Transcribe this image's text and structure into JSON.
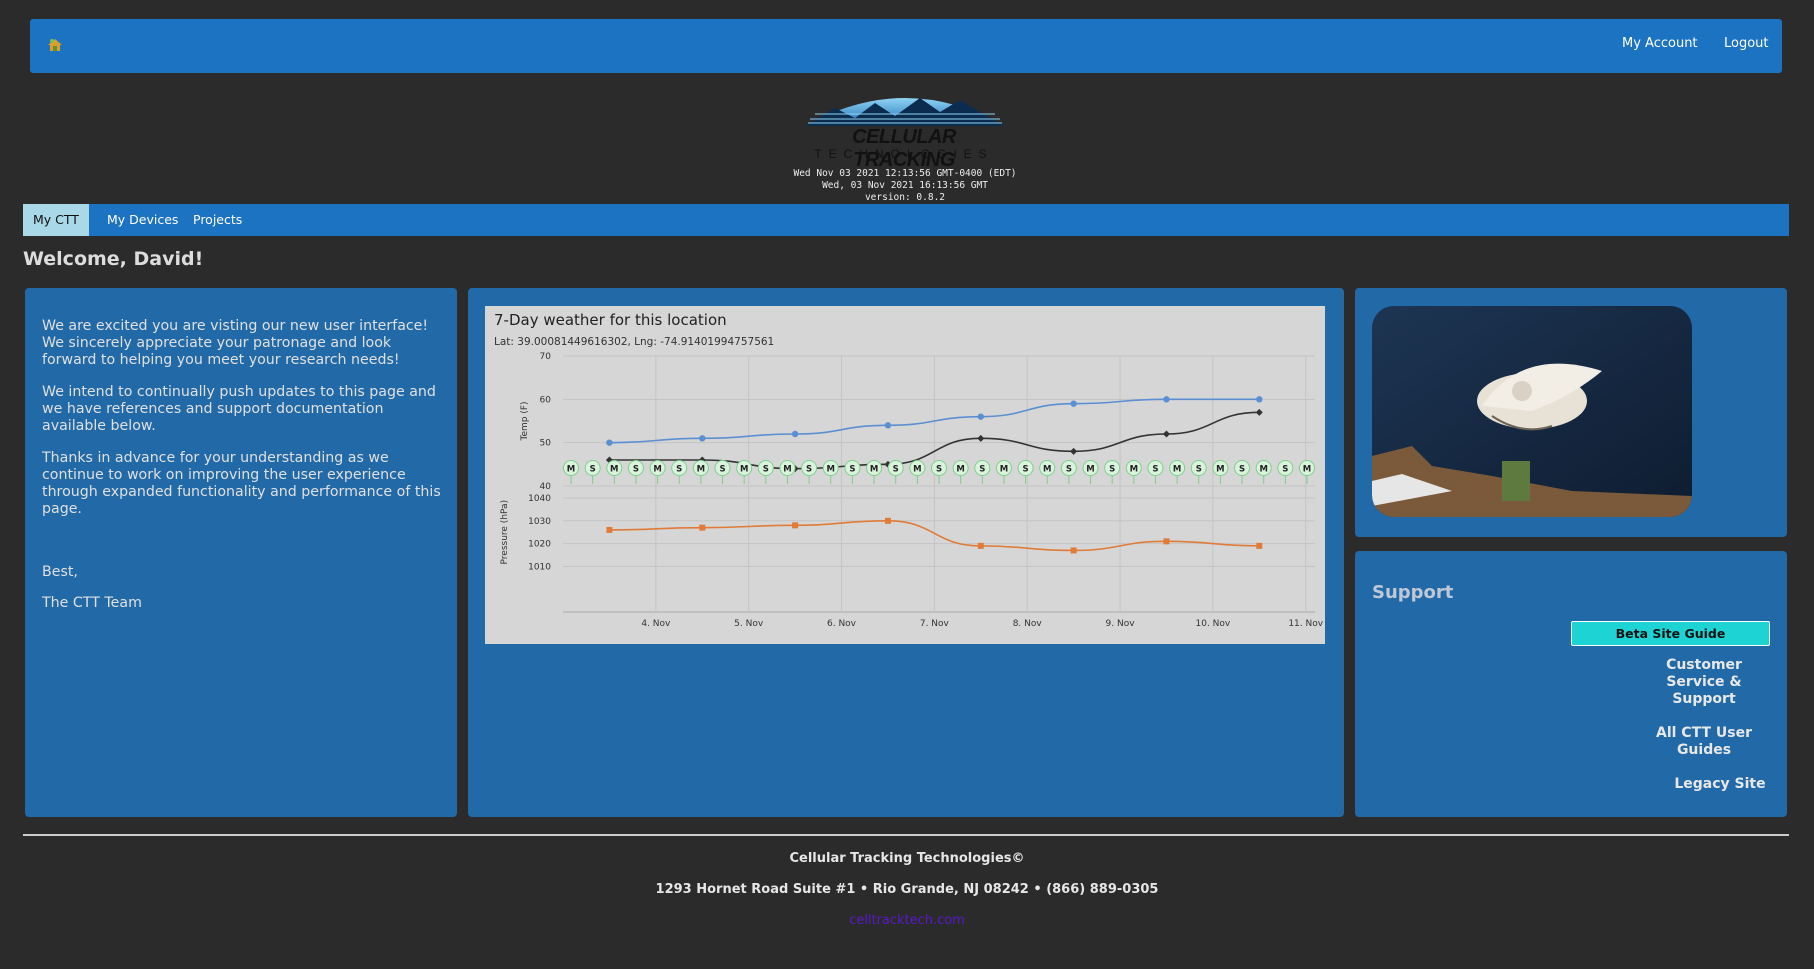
{
  "header": {
    "my_account": "My Account",
    "logout": "Logout"
  },
  "logo": {
    "line1": "CELLULAR TRACKING",
    "line2": "TECHNOLOGIES"
  },
  "time_info": {
    "local": "Wed Nov 03 2021 12:13:56 GMT-0400 (EDT)",
    "utc": "Wed, 03 Nov 2021 16:13:56 GMT",
    "version": "version: 0.8.2"
  },
  "nav": {
    "items": [
      {
        "label": "My CTT",
        "active": true
      },
      {
        "label": "My Devices",
        "active": false
      },
      {
        "label": "Projects",
        "active": false
      }
    ]
  },
  "welcome": "Welcome, David!",
  "intro": {
    "p1": "We are excited you are visting our new user interface! We sincerely appreciate your patronage and look forward to helping you meet your research needs!",
    "p2": "We intend to continually push updates to this page and we have references and support documentation available below.",
    "p3": "Thanks in advance for your understanding as we continue to work on improving the user experience through expanded functionality and performance of this page.",
    "signoff": "Best,",
    "signature": "The CTT Team"
  },
  "weather": {
    "title": "7-Day weather for this location",
    "subtitle": "Lat: 39.00081449616302, Lng: -74.91401994757561"
  },
  "chart_data": {
    "type": "line",
    "x_categories": [
      "4. Nov",
      "5. Nov",
      "6. Nov",
      "7. Nov",
      "8. Nov",
      "9. Nov",
      "10. Nov",
      "11. Nov"
    ],
    "temp_axis": {
      "label": "Temp (F)",
      "ticks": [
        70,
        60,
        50,
        40
      ],
      "ylim": [
        40,
        70
      ]
    },
    "pressure_axis": {
      "label": "Pressure (hPa)",
      "ticks": [
        1040,
        1030,
        1020,
        1010
      ],
      "ylim": [
        990,
        1040
      ]
    },
    "x_days": [
      3.5,
      4.5,
      5.5,
      6.5,
      7.5,
      8.5,
      9.5,
      10.5
    ],
    "series": [
      {
        "color": "#5b8fd1",
        "axis": "temp",
        "values": [
          50,
          51,
          52,
          54,
          56,
          59,
          60,
          60
        ]
      },
      {
        "color": "#333333",
        "axis": "temp",
        "values": [
          46,
          46,
          44,
          45,
          51,
          48,
          52,
          57
        ]
      },
      {
        "color": "#e07b39",
        "axis": "pressure",
        "values": [
          1026,
          1027,
          1028,
          1030,
          1019,
          1017,
          1021,
          1019
        ]
      }
    ],
    "markers": [
      "M",
      "S",
      "M",
      "S",
      "M",
      "S",
      "M",
      "S",
      "M",
      "S",
      "M",
      "S",
      "M",
      "S",
      "M",
      "S",
      "M",
      "S",
      "M",
      "S",
      "M",
      "S",
      "M",
      "S",
      "M",
      "S",
      "M",
      "S",
      "M",
      "S",
      "M",
      "S",
      "M",
      "S",
      "M"
    ]
  },
  "support": {
    "title": "Support",
    "beta_guide": "Beta Site Guide",
    "customer_service": "Customer Service & Support",
    "user_guides": "All CTT User Guides",
    "legacy": "Legacy Site"
  },
  "footer": {
    "company": "Cellular Tracking Technologies©",
    "address": "1293 Hornet Road Suite #1 • Rio Grande, NJ 08242 • (866) 889-0305",
    "link": "celltracktech.com"
  },
  "colors": {
    "background": "#2b2b2b",
    "bar_blue": "#1c73c2",
    "panel_blue": "#2169a7",
    "active_tab": "#a9d8e8",
    "beta_button": "#1ed3d3"
  }
}
